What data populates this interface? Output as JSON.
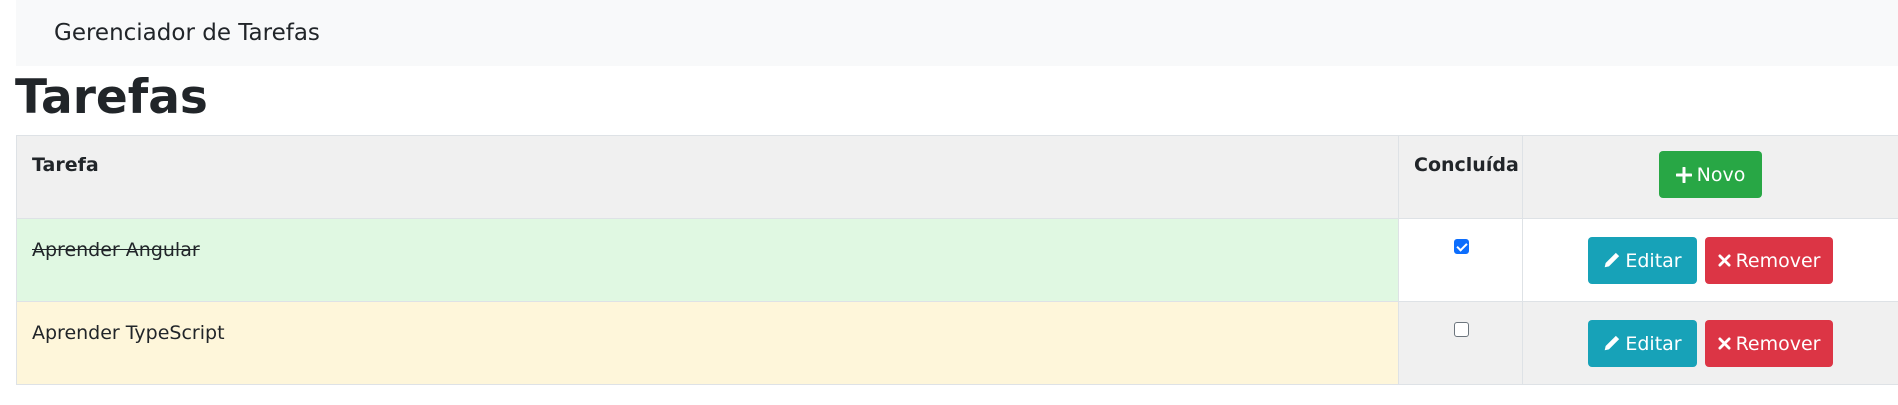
{
  "navbar": {
    "brand": "Gerenciador de Tarefas"
  },
  "page": {
    "title": "Tarefas"
  },
  "table": {
    "headers": {
      "task": "Tarefa",
      "done": "Concluída"
    },
    "new_button": "Novo",
    "rows": [
      {
        "task": "Aprender Angular",
        "done": true,
        "edit": "Editar",
        "remove": "Remover"
      },
      {
        "task": "Aprender TypeScript",
        "done": false,
        "edit": "Editar",
        "remove": "Remover"
      }
    ]
  },
  "colors": {
    "success": "#28a745",
    "info": "#17a2b8",
    "danger": "#dc3545",
    "row_done_bg": "#e0f8e2",
    "row_pending_bg": "#fef6da",
    "checkbox_checked": "#0d6efd"
  },
  "icons": {
    "new": "plus-icon",
    "edit": "pencil-icon",
    "remove": "x-icon"
  }
}
